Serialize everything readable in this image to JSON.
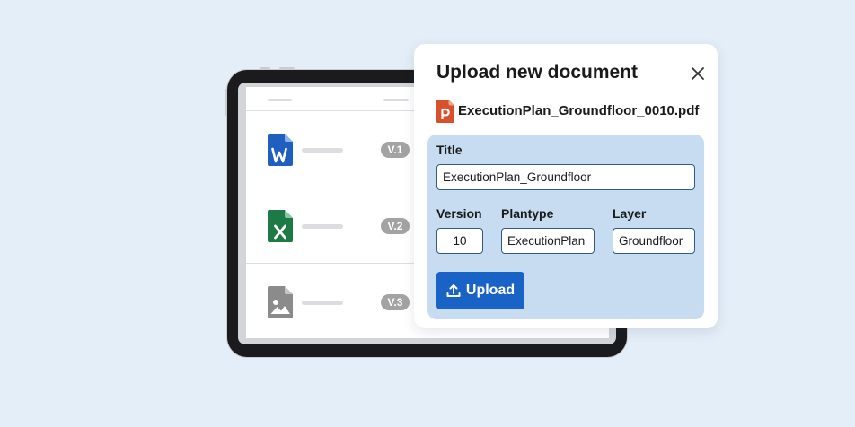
{
  "dialog": {
    "title": "Upload new document",
    "file_name": "ExecutionPlan_Groundfloor_0010.pdf",
    "form": {
      "title_label": "Title",
      "title_value": "ExecutionPlan_Groundfloor",
      "version_label": "Version",
      "version_value": "10",
      "plantype_label": "Plantype",
      "plantype_value": "ExecutionPlan",
      "layer_label": "Layer",
      "layer_value": "Groundfloor"
    },
    "upload_label": "Upload"
  },
  "document_list": {
    "rows": [
      {
        "icon": "word-file-icon",
        "version": "V.1"
      },
      {
        "icon": "excel-file-icon",
        "version": "V.2"
      },
      {
        "icon": "image-file-icon",
        "version": "V.3"
      }
    ]
  },
  "colors": {
    "background": "#e4eef8",
    "form_panel": "#c7dcf1",
    "primary_button": "#1a63c6",
    "word": "#1f5fc0",
    "excel": "#1d7a45",
    "pdf": "#d9512c",
    "image": "#8b8b8b",
    "version_badge": "#a3a3a3"
  }
}
